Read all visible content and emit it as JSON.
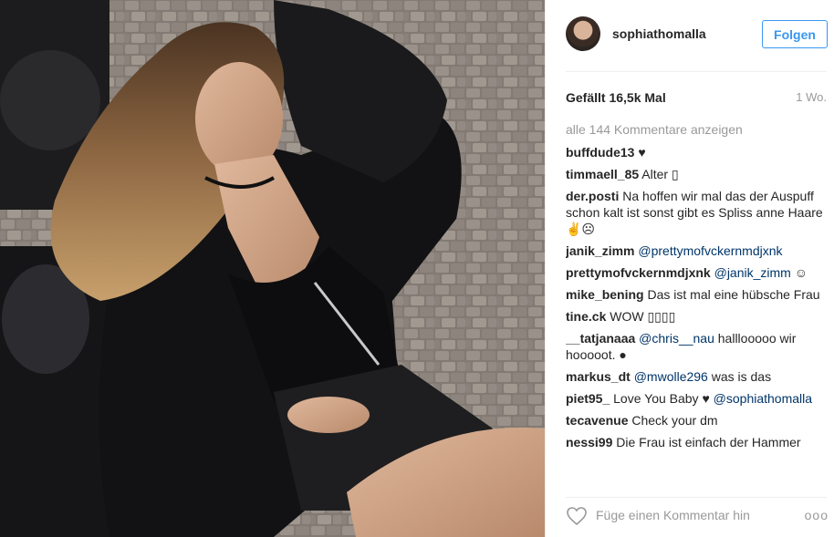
{
  "post": {
    "username": "sophiathomalla",
    "follow_label": "Folgen",
    "likes": "Gefällt 16,5k Mal",
    "age": "1 Wo.",
    "load_more": "alle 144 Kommentare anzeigen",
    "comments": [
      {
        "user": "buffdude13",
        "text": "♥"
      },
      {
        "user": "timmaell_85",
        "text": "Alter ▯"
      },
      {
        "user": "der.posti",
        "text": "Na hoffen wir mal das der Auspuff schon kalt ist sonst gibt es Spliss anne Haare ✌☹"
      },
      {
        "user": "janik_zimm",
        "mention": "@prettymofvckernmdjxnk",
        "text": ""
      },
      {
        "user": "prettymofvckernmdjxnk",
        "mention": "@janik_zimm",
        "text": "☺"
      },
      {
        "user": "mike_bening",
        "text": "Das ist mal eine hübsche Frau"
      },
      {
        "user": "tine.ck",
        "text": "WOW ▯▯▯▯"
      },
      {
        "user": "__tatjanaaa",
        "mention": "@chris__nau",
        "text": "halllooooo wir hooooot. ●"
      },
      {
        "user": "markus_dt",
        "mention": "@mwolle296",
        "text": "was is das"
      },
      {
        "user": "piet95_",
        "text": "Love You Baby ♥",
        "mention_after": "@sophiathomalla"
      },
      {
        "user": "tecavenue",
        "text": "Check your dm"
      },
      {
        "user": "nessi99",
        "text": "Die Frau ist einfach der Hammer"
      }
    ],
    "comment_placeholder": "Füge einen Kommentar hin",
    "more_label": "ooo"
  },
  "colors": {
    "link": "#3897f0",
    "mention": "#003569",
    "muted": "#999999",
    "divider": "#efefef"
  },
  "icons": {
    "like": "heart-outline-icon",
    "options": "more-options-icon"
  }
}
